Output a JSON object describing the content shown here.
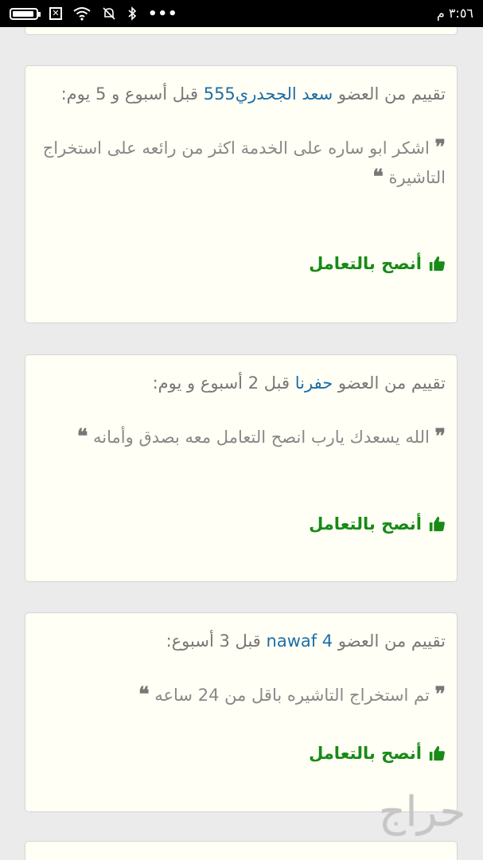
{
  "status_bar": {
    "time": "٣:٥٦ م",
    "icons": [
      "more-dots-icon",
      "bluetooth-icon",
      "notifications-off-icon",
      "wifi-icon",
      "sim-icon",
      "battery-icon"
    ]
  },
  "reviews": [
    {
      "prefix": "تقييم من العضو",
      "member": "سعد الجحدري555",
      "suffix": "قبل أسبوع و 5 يوم:",
      "text": "اشكر ابو ساره على الخدمة اكثر من رائعه على استخراج التاشيرة",
      "recommend": "أنصح بالتعامل"
    },
    {
      "prefix": "تقييم من العضو",
      "member": "حفرنا",
      "suffix": "قبل 2 أسبوع و يوم:",
      "text": "الله يسعدك يارب انصح التعامل معه بصدق وأمانه",
      "recommend": "أنصح بالتعامل"
    },
    {
      "prefix": "تقييم من العضو",
      "member": "nawaf 4",
      "suffix": "قبل 3 أسبوع:",
      "text": "تم استخراج التاشيره باقل من 24 ساعه",
      "recommend": "أنصح بالتعامل"
    }
  ],
  "watermark": "حراج",
  "colors": {
    "link": "#1d6ea8",
    "recommend": "#178a17",
    "card_bg": "#fffff5",
    "page_bg": "#ebebeb"
  }
}
